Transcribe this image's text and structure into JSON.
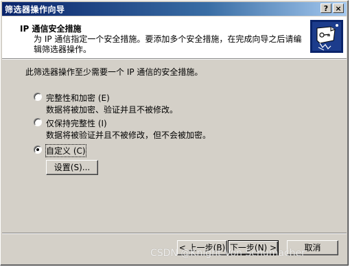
{
  "window": {
    "title": "筛选器操作向导",
    "help_label": "?",
    "close_label": "×"
  },
  "header": {
    "title": "IP 通信安全措施",
    "subtitle": "为 IP 通信指定一个安全措施。要添加多个安全措施，在完成向导之后请编辑筛选器操作。",
    "icon": "security-wizard-icon"
  },
  "body": {
    "intro": "此筛选器操作至少需要一个 IP 通信的安全措施。",
    "options": [
      {
        "label": "完整性和加密 (E)",
        "description": "数据将被加密、验证并且不被修改。",
        "checked": false
      },
      {
        "label": "仅保持完整性 (I)",
        "description": "数据将被验证并且不被修改，但不会被加密。",
        "checked": false
      },
      {
        "label": "自定义 (C)",
        "description": "",
        "checked": true
      }
    ],
    "settings_button": "设置(S)..."
  },
  "footer": {
    "back": "< 上一步(B)",
    "next": "下一步(N) >",
    "cancel": "取消"
  },
  "watermark": "CSDN @Knight Von Schumacher",
  "colors": {
    "title_gradient_start": "#0a246a",
    "title_gradient_end": "#a6caf0",
    "dialog_bg": "#d4d0c8"
  }
}
